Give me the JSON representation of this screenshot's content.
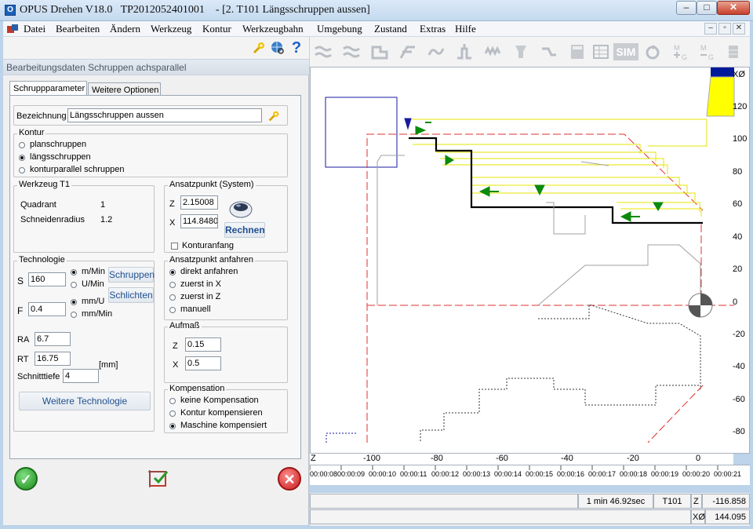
{
  "window": {
    "title": "OPUS Drehen V18.0   TP2012052401001    - [2. T101 Längsschruppen aussen]",
    "minimize": "–",
    "maximize": "□",
    "close": "✕",
    "mdi_minimize": "–",
    "mdi_restore": "▫",
    "mdi_close": "✕"
  },
  "menu": [
    "Datei",
    "Bearbeiten",
    "Ändern",
    "Werkzeug",
    "Kontur",
    "Werkzeugbahn",
    "Umgebung",
    "Zustand",
    "Extras",
    "Hilfe"
  ],
  "panel": {
    "header": "Bearbeitungsdaten Schruppen achsparallel",
    "tabs": [
      "Schruppparameter",
      "Weitere Optionen"
    ],
    "bezeichnung_label": "Bezeichnung",
    "bezeichnung_value": "Längsschruppen aussen",
    "kontur": {
      "title": "Kontur",
      "options": [
        "planschruppen",
        "längsschruppen",
        "konturparallel schruppen"
      ],
      "selected": 1
    },
    "werkzeug": {
      "title": "Werkzeug T1",
      "quadrant_label": "Quadrant",
      "quadrant_value": "1",
      "radius_label": "Schneidenradius",
      "radius_value": "1.2"
    },
    "ansatzpunkt_system": {
      "title": "Ansatzpunkt (System)",
      "z_label": "Z",
      "z_value": "2.15008",
      "x_label": "X",
      "x_value": "114.8480",
      "rechnen_label": "Rechnen",
      "konturanfang_label": "Konturanfang"
    },
    "technologie": {
      "title": "Technologie",
      "s_label": "S",
      "s_value": "160",
      "s_units": [
        "m/Min",
        "U/Min"
      ],
      "s_unit_selected": 0,
      "f_label": "F",
      "f_value": "0.4",
      "f_units": [
        "mm/U",
        "mm/Min"
      ],
      "f_unit_selected": 0,
      "schruppen_label": "Schruppen",
      "schlichten_label": "Schlichten",
      "ra_label": "RA",
      "ra_value": "6.7",
      "rt_label": "RT",
      "rt_value": "16.75",
      "mm_label": "[mm]",
      "schnitttiefe_label": "Schnitttiefe",
      "schnitttiefe_value": "4",
      "weitere_label": "Weitere Technologie"
    },
    "ansatzpunkt_anfahren": {
      "title": "Ansatzpunkt anfahren",
      "options": [
        "direkt anfahren",
        "zuerst in X",
        "zuerst in Z",
        "manuell"
      ],
      "selected": 0
    },
    "aufmass": {
      "title": "Aufmaß",
      "z_label": "Z",
      "z_value": "0.15",
      "x_label": "X",
      "x_value": "0.5"
    },
    "kompensation": {
      "title": "Kompensation",
      "options": [
        "keine Kompensation",
        "Kontur kompensieren",
        "Maschine kompensiert"
      ],
      "selected": 2
    }
  },
  "canvas": {
    "x_axis_title": "XØ",
    "x_ticks": [
      "120",
      "100",
      "80",
      "60",
      "40",
      "20",
      "0",
      "-20",
      "-40",
      "-60",
      "-80"
    ],
    "z_axis_title": "Z",
    "z_ticks": [
      "-100",
      "-80",
      "-60",
      "-40",
      "-20",
      "0"
    ],
    "time_ticks": [
      "00:00:08",
      "00:00:09",
      "00:00:10",
      "00:00:11",
      "00:00:12",
      "00:00:13",
      "00:00:14",
      "00:00:15",
      "00:00:16",
      "00:00:17",
      "00:00:18",
      "00:00:19",
      "00:00:20",
      "00:00:21"
    ]
  },
  "status": {
    "time": "1 min 46.92sec",
    "tool": "T101",
    "z_label": "Z",
    "z_value": "-116.858",
    "x_label": "XØ",
    "x_value": "144.095"
  },
  "colors": {
    "toolpath_yellow": "#ffff00",
    "contour_red": "#e03030",
    "finished_black": "#000000",
    "arrow_green": "#0a8a0a",
    "stock_blue": "#1a1aa0"
  }
}
